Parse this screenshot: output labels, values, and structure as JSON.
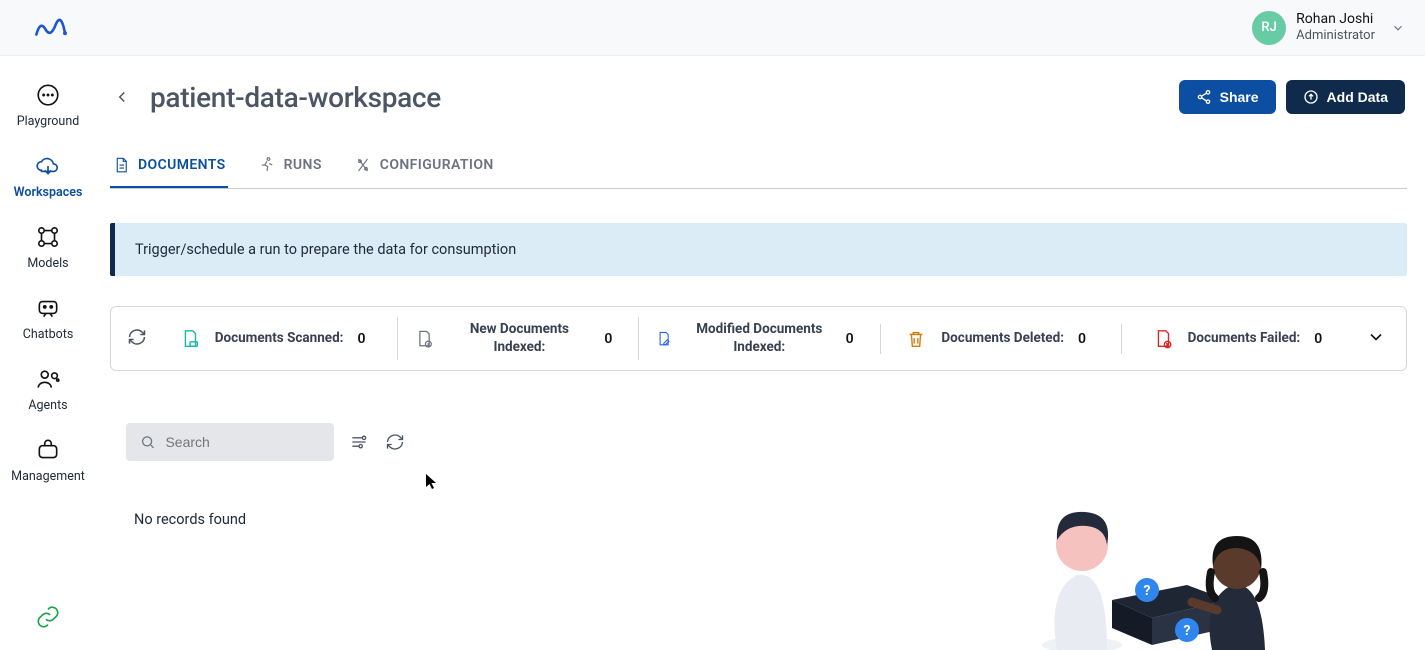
{
  "user": {
    "initials": "RJ",
    "name": "Rohan Joshi",
    "role": "Administrator"
  },
  "sidebar": {
    "items": [
      {
        "label": "Playground"
      },
      {
        "label": "Workspaces"
      },
      {
        "label": "Models"
      },
      {
        "label": "Chatbots"
      },
      {
        "label": "Agents"
      },
      {
        "label": "Management"
      }
    ]
  },
  "page": {
    "title": "patient-data-workspace"
  },
  "buttons": {
    "share": "Share",
    "add_data": "Add Data"
  },
  "tabs": [
    {
      "label": "DOCUMENTS"
    },
    {
      "label": "RUNS"
    },
    {
      "label": "CONFIGURATION"
    }
  ],
  "banner": {
    "text": "Trigger/schedule a run to prepare the data for consumption"
  },
  "stats": [
    {
      "label": "Documents Scanned:",
      "value": "0",
      "color": "#14b8a6"
    },
    {
      "label": "New Documents Indexed:",
      "value": "0",
      "color": "#6b7280"
    },
    {
      "label": "Modified Documents Indexed:",
      "value": "0",
      "color": "#2563eb"
    },
    {
      "label": "Documents Deleted:",
      "value": "0",
      "color": "#d97706"
    },
    {
      "label": "Documents Failed:",
      "value": "0",
      "color": "#dc2626"
    }
  ],
  "search": {
    "placeholder": "Search"
  },
  "table": {
    "empty_text": "No records found"
  }
}
